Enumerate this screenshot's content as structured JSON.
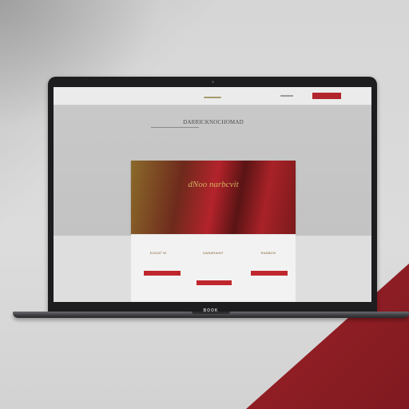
{
  "laptop": {
    "base_label": "BOOK"
  },
  "site": {
    "nav": {
      "button_label": ""
    },
    "hero": {
      "title": "DARRICKNOCHOMAD"
    },
    "feature": {
      "title": "dNoo narbcvit"
    },
    "columns": [
      {
        "heading": "EOGAT W",
        "button_label": ""
      },
      {
        "heading": "DANARAINT",
        "button_label": ""
      },
      {
        "heading": "RANBCN",
        "button_label": ""
      }
    ],
    "center_button_label": ""
  },
  "colors": {
    "brand_red": "#b3252c",
    "gold": "#d4b061",
    "backdrop_red": "#a9232b"
  }
}
